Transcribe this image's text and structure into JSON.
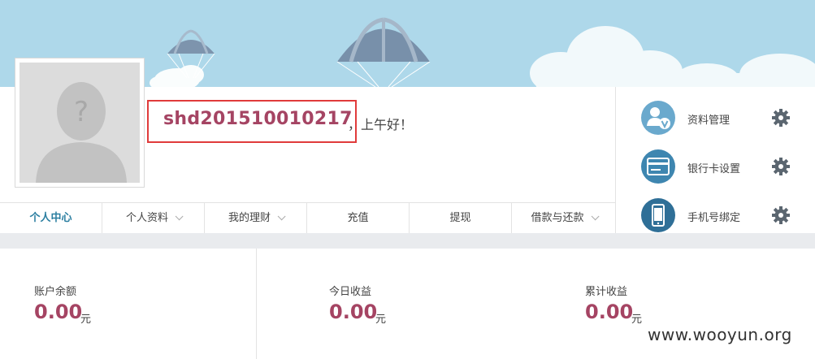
{
  "user": {
    "username": "shd201510010217",
    "greeting": "，上午好！"
  },
  "tabs": [
    {
      "label": "个人中心",
      "active": true,
      "has_dropdown": false
    },
    {
      "label": "个人资料",
      "active": false,
      "has_dropdown": true
    },
    {
      "label": "我的理财",
      "active": false,
      "has_dropdown": true
    },
    {
      "label": "充值",
      "active": false,
      "has_dropdown": false
    },
    {
      "label": "提现",
      "active": false,
      "has_dropdown": false
    },
    {
      "label": "借款与还款",
      "active": false,
      "has_dropdown": true
    }
  ],
  "side_menu": [
    {
      "label": "资料管理",
      "icon": "user-verified-icon"
    },
    {
      "label": "银行卡设置",
      "icon": "bank-card-icon"
    },
    {
      "label": "手机号绑定",
      "icon": "mobile-phone-icon"
    }
  ],
  "stats": [
    {
      "label": "账户余额",
      "value": "0.00",
      "unit": "元"
    },
    {
      "label": "今日收益",
      "value": "0.00",
      "unit": "元"
    },
    {
      "label": "累计收益",
      "value": "0.00",
      "unit": "元"
    }
  ],
  "watermark": "www.wooyun.org",
  "colors": {
    "sky": "#aed8ea",
    "accent": "#a54463",
    "active_tab": "#2c7fa1",
    "icon_blue": "#3e86b0",
    "highlight_border": "#e03b3b"
  }
}
